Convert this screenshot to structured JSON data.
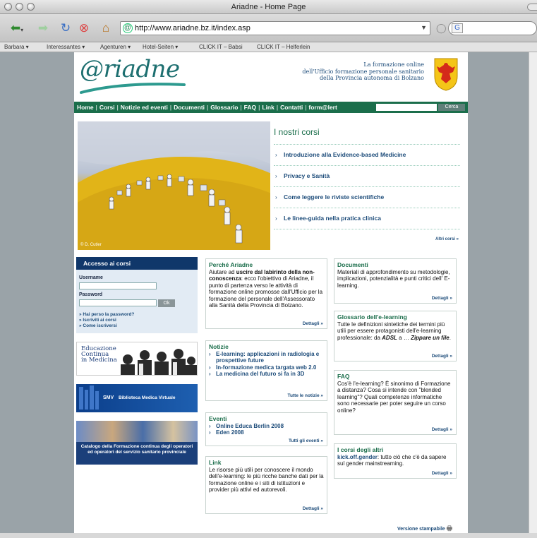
{
  "window": {
    "title": "Ariadne - Home Page"
  },
  "browser": {
    "url": "http://www.ariadne.bz.it/index.asp",
    "bookmarks": [
      "Barbara ▾",
      "Interessantes ▾",
      "Agenturen ▾",
      "Hotel-Seiten ▾",
      "CLICK IT – Babsi",
      "CLICK IT – Helferlein"
    ]
  },
  "header": {
    "logo": "@riadne",
    "tagline": [
      "La formazione online",
      "dell'Ufficio formazione personale sanitario",
      "della Provincia autonoma di Bolzano"
    ]
  },
  "nav": {
    "links": [
      "Home",
      "Corsi",
      "Notizie ed eventi",
      "Documenti",
      "Glossario",
      "FAQ",
      "Link",
      "Contatti",
      "form@lert"
    ],
    "search_button": "Cerca"
  },
  "hero": {
    "credit": "© D. Cutler"
  },
  "corsi": {
    "title": "I nostri corsi",
    "items": [
      "Introduzione alla Evidence-based Medicine",
      "Privacy e Sanità",
      "Come leggere le riviste scientifiche",
      "Le linee-guida nella pratica clinica"
    ],
    "more": "Altri corsi »"
  },
  "login": {
    "title": "Accesso ai corsi",
    "username_label": "Username",
    "password_label": "Password",
    "ok": "Ok",
    "links": [
      "» Hai perso la password?",
      "» Iscriviti ai corsi",
      "» Come iscriversi"
    ]
  },
  "banners": {
    "ecm": [
      "Educazione",
      "Continua",
      "in Medicina"
    ],
    "smv": "Biblioteca Medica Virtuale",
    "smv_short": "SMV",
    "catalogo": "Catalogo della Formazione continua degli operatori ed operatori del servizio sanitario provinciale"
  },
  "perche": {
    "title": "Perché Ariadne",
    "text_pre": "Aiutare ad ",
    "text_bold": "uscire dal labirinto della non-conoscenza",
    "text_post": ": ecco l'obiettivo di Ariadne, il punto di partenza verso le attività di formazione online promosse dall'Ufficio per la formazione del personale dell'Assessorato alla Sanità della Provincia di Bolzano.",
    "more": "Dettagli »"
  },
  "notizie": {
    "title": "Notizie",
    "items": [
      "E-learning: applicazioni in radiologia e prospettive future",
      "In-formazione medica targata web 2.0",
      "La medicina del futuro si fa in 3D"
    ],
    "more": "Tutte le notizie »"
  },
  "eventi": {
    "title": "Eventi",
    "items": [
      "Online Educa Berlin 2008",
      "Eden 2008"
    ],
    "more": "Tutti gli eventi »"
  },
  "link": {
    "title": "Link",
    "text": "Le risorse più utili per conoscere il mondo dell'e-learning: le più ricche banche dati per la formazione online e i siti di istituzioni e provider più attivi ed autorevoli.",
    "more": "Dettagli »"
  },
  "documenti": {
    "title": "Documenti",
    "text": "Materiali di approfondimento su metodologie, implicazioni, potenzialità e punti critici dell' E-learning.",
    "more": "Dettagli »"
  },
  "glossario": {
    "title": "Glossario dell'e-learning",
    "text_pre": "Tutte le definizioni sintetiche dei termini più utili per essere protagonisti dell'e-learning professionale: da ",
    "text_b1": "ADSL",
    "text_mid": " a … ",
    "text_b2": "Zippare un file",
    "text_end": ".",
    "more": "Dettagli »"
  },
  "faq": {
    "title": "FAQ",
    "text": "Cos'è l'e-learning? È sinonimo di Formazione a distanza? Cosa si intende con \"blended learning\"? Quali competenze informatiche sono necessarie per poter seguire un corso online?",
    "more": "Dettagli »"
  },
  "altri": {
    "title": "I corsi degli altri",
    "text_bold": "kick.off.gender",
    "text_post": ": tutto ciò che c'è da sapere sul gender mainstreaming.",
    "more": "Dettagli »"
  },
  "footer": {
    "print": "Versione stampabile"
  },
  "colors": {
    "nav_green": "#1b6e4b",
    "login_blue": "#10376a",
    "link_blue": "#1d4c7a"
  }
}
